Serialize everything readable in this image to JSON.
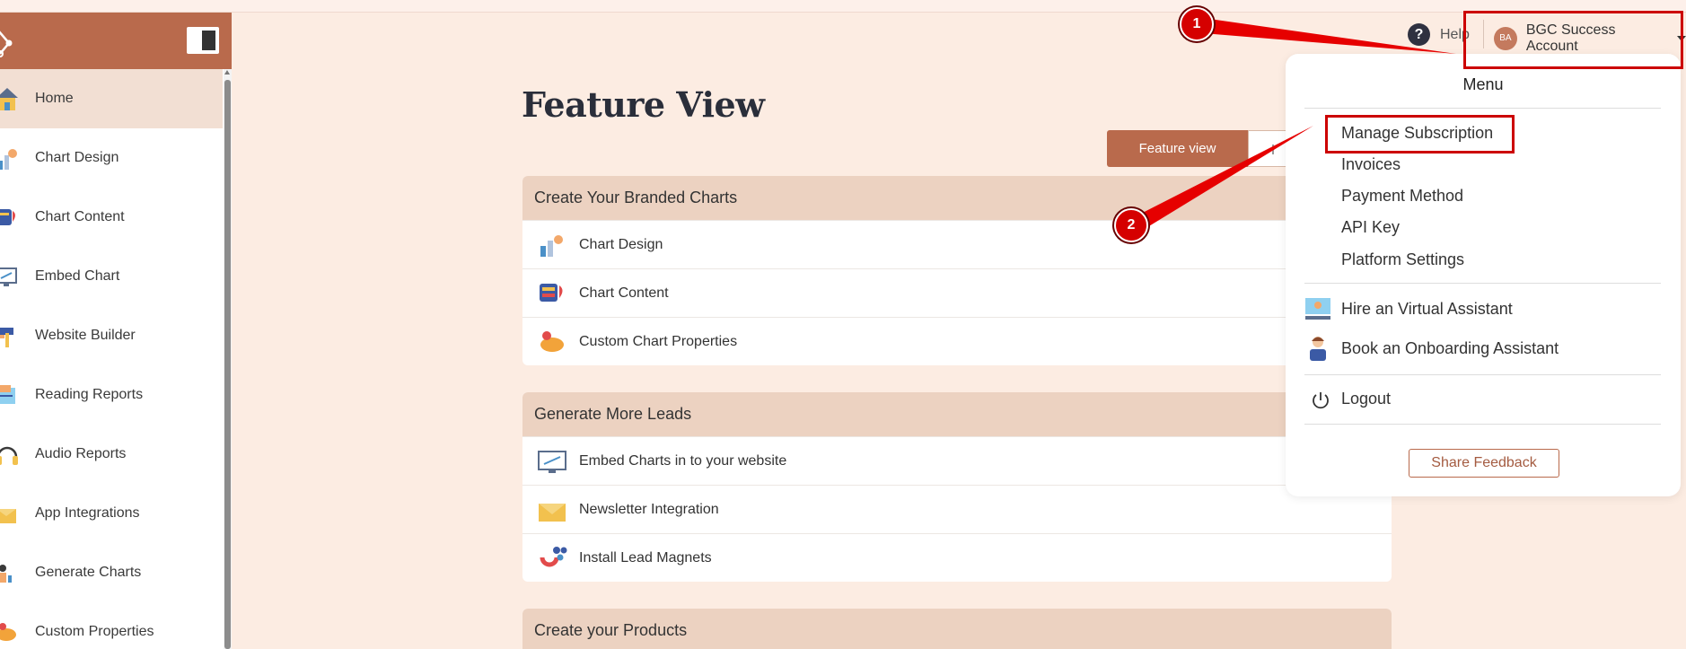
{
  "sidebar": {
    "items": [
      {
        "label": "Home",
        "icon": "home-icon"
      },
      {
        "label": "Chart Design",
        "icon": "chart-design-icon"
      },
      {
        "label": "Chart Content",
        "icon": "chart-content-icon"
      },
      {
        "label": "Embed Chart",
        "icon": "embed-chart-icon"
      },
      {
        "label": "Website Builder",
        "icon": "website-builder-icon"
      },
      {
        "label": "Reading Reports",
        "icon": "reading-reports-icon"
      },
      {
        "label": "Audio Reports",
        "icon": "headphones-icon"
      },
      {
        "label": "App Integrations",
        "icon": "app-integrations-icon"
      },
      {
        "label": "Generate Charts",
        "icon": "generate-charts-icon"
      },
      {
        "label": "Custom Properties",
        "icon": "custom-properties-icon"
      }
    ]
  },
  "header": {
    "help_label": "Help",
    "help_icon_glyph": "?",
    "avatar_initials": "BA",
    "account_name": "BGC Success Account"
  },
  "main": {
    "title": "Feature View",
    "view_button": "Feature view",
    "cards": [
      {
        "heading": "Create Your Branded Charts",
        "rows": [
          "Chart Design",
          "Chart Content",
          "Custom Chart Properties"
        ]
      },
      {
        "heading": "Generate More Leads",
        "rows": [
          "Embed Charts in to your website",
          "Newsletter Integration",
          "Install Lead Magnets"
        ]
      },
      {
        "heading": "Create your Products",
        "rows": []
      }
    ]
  },
  "menu": {
    "title": "Menu",
    "items": [
      "Manage Subscription",
      "Invoices",
      "Payment Method",
      "API Key",
      "Platform Settings"
    ],
    "hire_assistant": "Hire an Virtual Assistant",
    "book_assistant": "Book an Onboarding Assistant",
    "logout": "Logout",
    "share_feedback": "Share Feedback"
  },
  "annotations": {
    "badge_1": "1",
    "badge_2": "2"
  },
  "colors": {
    "brand": "#b96a4c",
    "background": "#fcece2",
    "card_header": "#ecd2c1",
    "annotation_red": "#cc0000"
  }
}
